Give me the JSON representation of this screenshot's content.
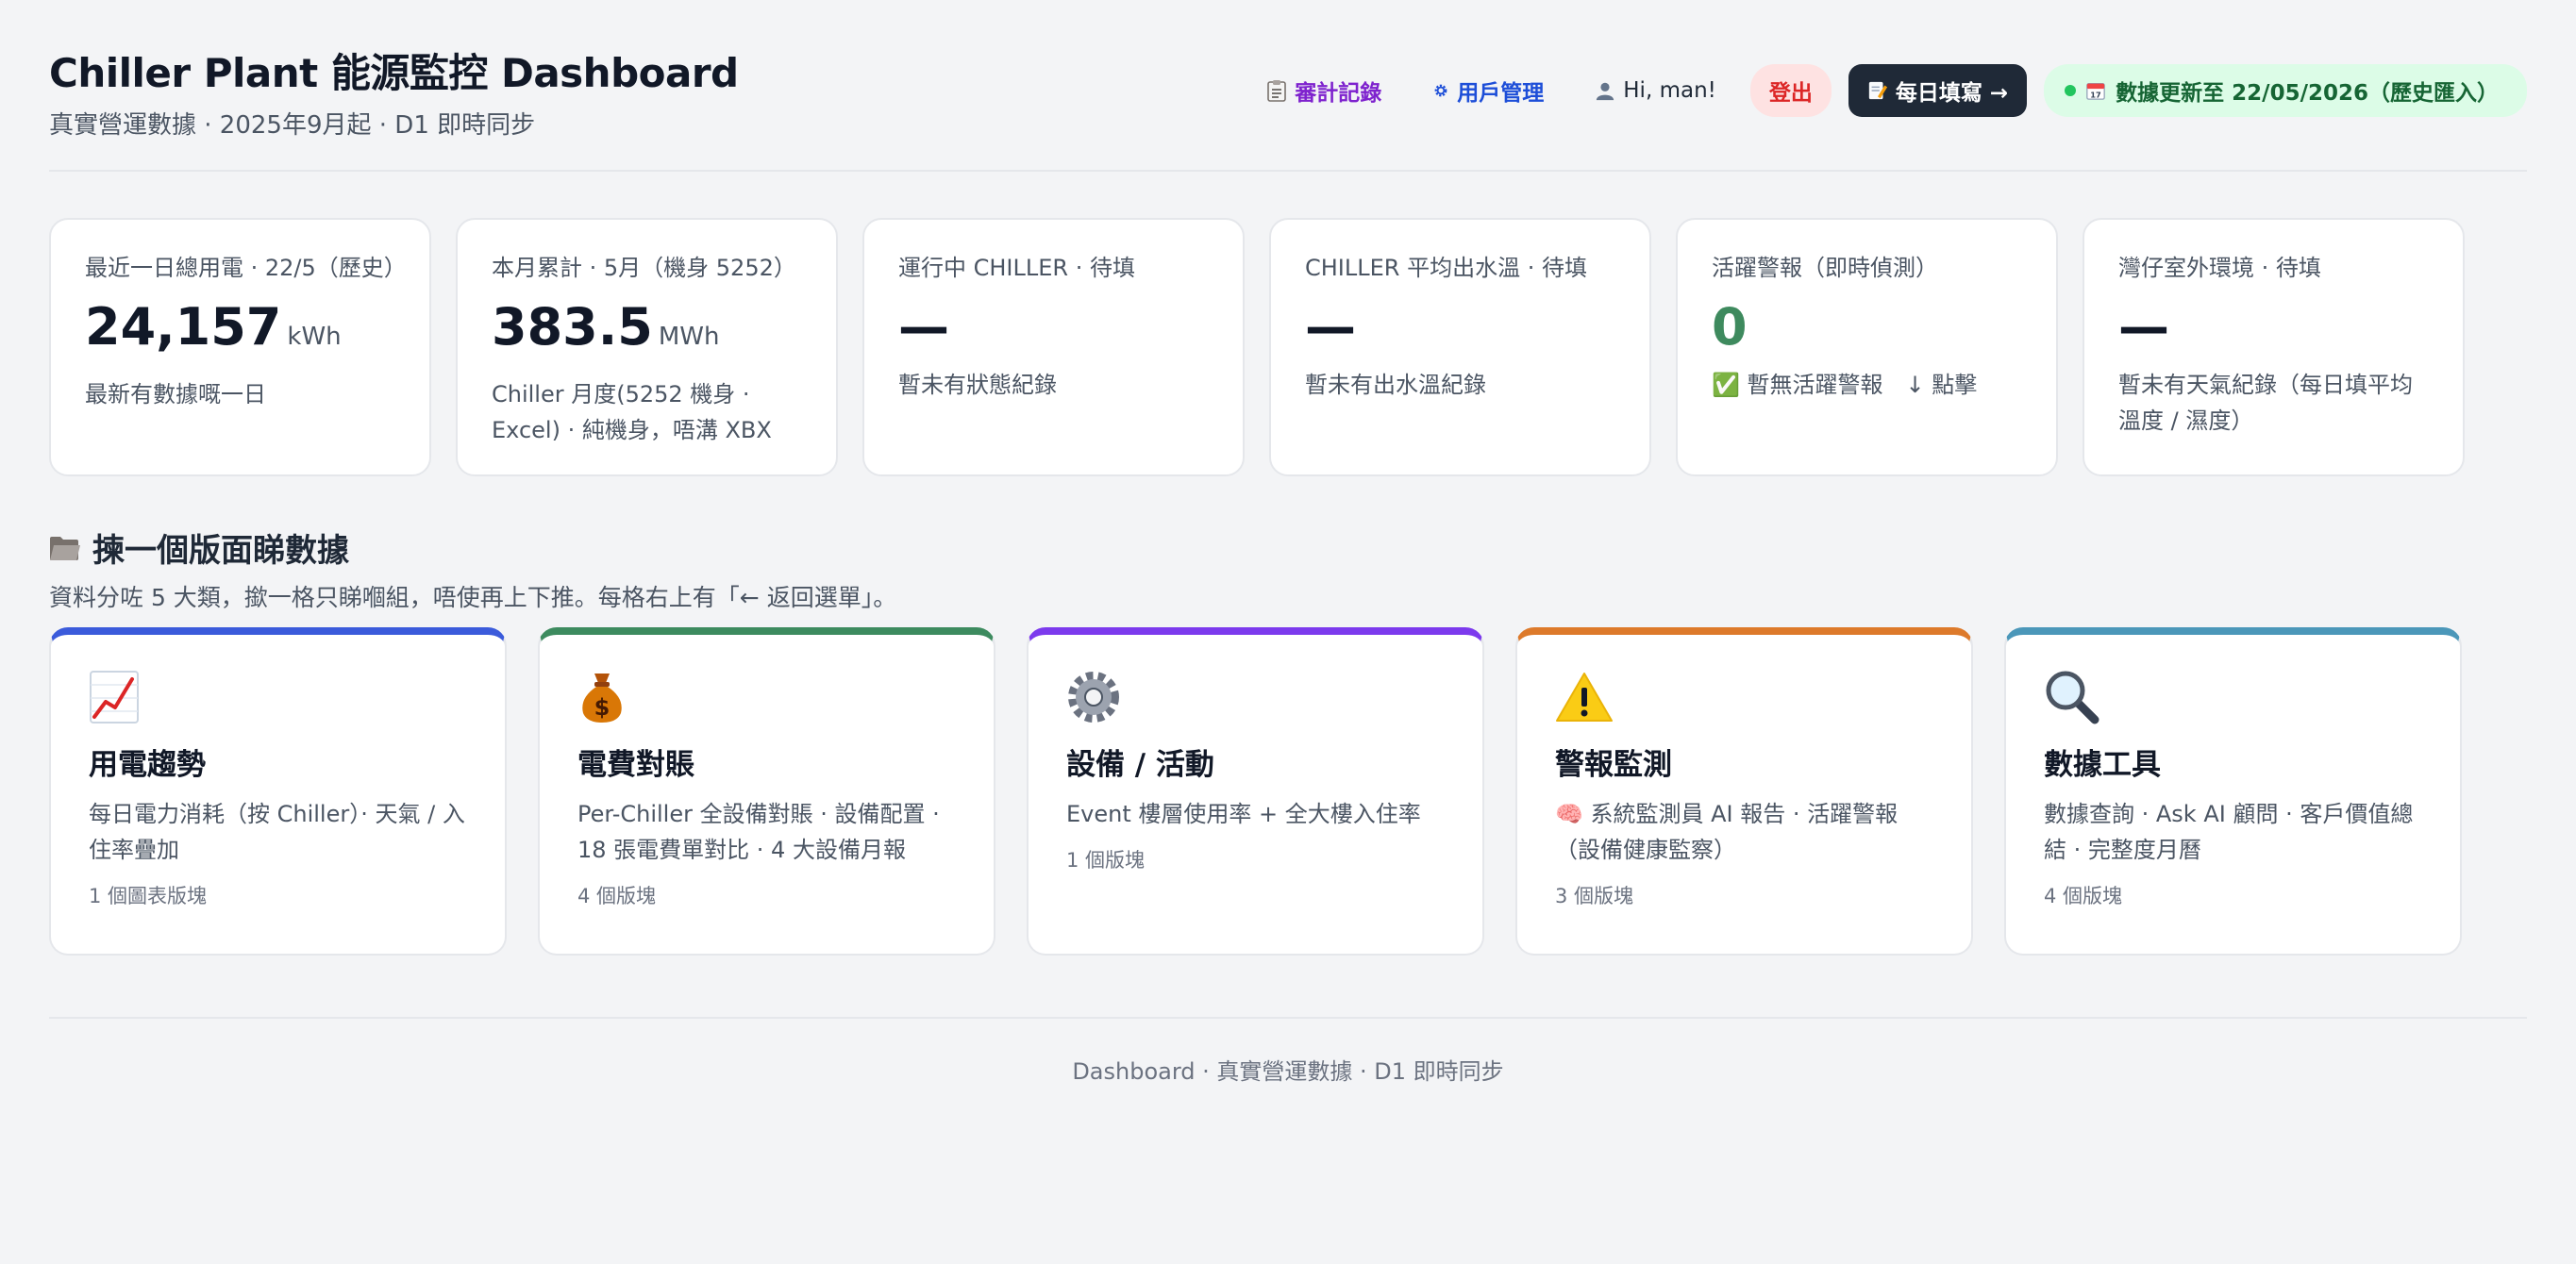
{
  "header": {
    "title": "Chiller Plant 能源監控 Dashboard",
    "subtitle": "真實營運數據 · 2025年9月起 · D1 即時同步",
    "audit_label": "審計記錄",
    "users_label": "用戶管理",
    "greeting": "Hi, man!",
    "logout_label": "登出",
    "daily_label": "每日填寫 →",
    "status_label": "數據更新至 22/05/2026（歷史匯入）",
    "status_color": "#22c55e"
  },
  "kpis": [
    {
      "label": "最近一日總用電 · 22/5（歷史）",
      "value": "24,157",
      "unit": "kWh",
      "note": "最新有數據嘅一日"
    },
    {
      "label": "本月累計 · 5月（機身 5252）",
      "value": "383.5",
      "unit": "MWh",
      "note": "Chiller 月度(5252 機身 · Excel) · 純機身，唔溝 XBX"
    },
    {
      "label": "運行中 CHILLER · 待填",
      "value": "—",
      "unit": "",
      "note": "暫未有狀態紀錄"
    },
    {
      "label": "CHILLER 平均出水溫 · 待填",
      "value": "—",
      "unit": "",
      "note": "暫未有出水溫紀錄"
    },
    {
      "label": "活躍警報（即時偵測）",
      "value": "0",
      "unit": "",
      "note": "✅ 暫無活躍警報　↓ 點擊"
    },
    {
      "label": "灣仔室外環境 · 待填",
      "value": "—",
      "unit": "",
      "note": "暫未有天氣紀錄（每日填平均溫度 / 濕度）"
    }
  ],
  "section": {
    "title": "揀一個版面睇數據",
    "desc": "資料分咗 5 大類，撳一格只睇嗰組，唔使再上下推。每格右上有「← 返回選單」。"
  },
  "panels": [
    {
      "icon": "chart-icon",
      "title": "用電趨勢",
      "desc": "每日電力消耗（按 Chiller）· 天氣 / 入住率疊加",
      "count": "1 個圖表版塊",
      "accent": "#3b5bdb"
    },
    {
      "icon": "money-bag-icon",
      "title": "電費對賬",
      "desc": "Per-Chiller 全設備對賬 · 設備配置 · 18 張電費單對比 · 4 大設備月報",
      "count": "4 個版塊",
      "accent": "#3d8b5f"
    },
    {
      "icon": "gear-icon",
      "title": "設備 / 活動",
      "desc": "Event 樓層使用率 + 全大樓入住率",
      "count": "1 個版塊",
      "accent": "#7c3aed"
    },
    {
      "icon": "warning-icon",
      "title": "警報監測",
      "desc": "🧠 系統監測員 AI 報告 · 活躍警報（設備健康監察）",
      "count": "3 個版塊",
      "accent": "#dd7a2b"
    },
    {
      "icon": "magnifier-icon",
      "title": "數據工具",
      "desc": "數據查詢 · Ask AI 顧問 · 客戶價值總結 · 完整度月曆",
      "count": "4 個版塊",
      "accent": "#4b97b9"
    }
  ],
  "footer": "Dashboard · 真實營運數據 · D1 即時同步"
}
